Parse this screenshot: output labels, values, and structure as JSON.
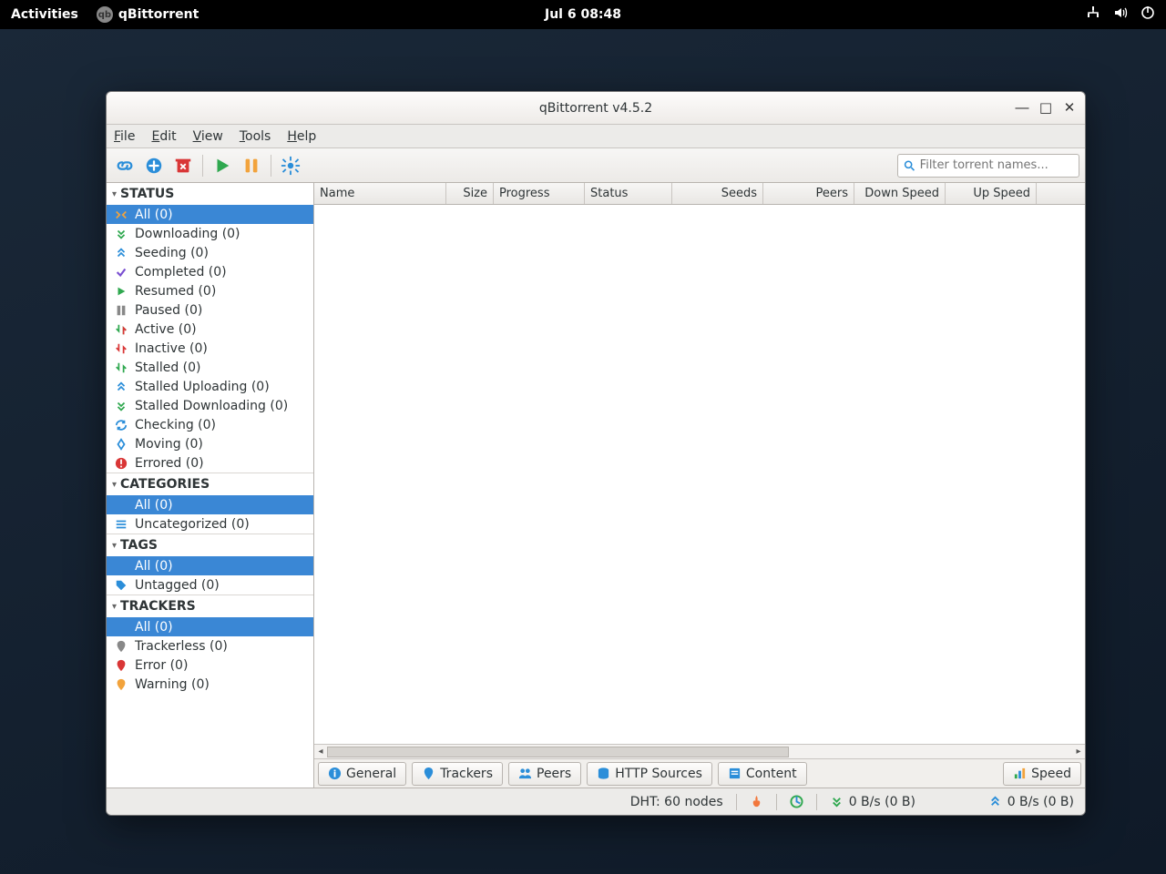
{
  "topbar": {
    "activities": "Activities",
    "app_name": "qBittorrent",
    "datetime": "Jul 6  08:48"
  },
  "window": {
    "title": "qBittorrent v4.5.2"
  },
  "menu": {
    "file": "File",
    "edit": "Edit",
    "view": "View",
    "tools": "Tools",
    "help": "Help"
  },
  "search": {
    "placeholder": "Filter torrent names..."
  },
  "columns": {
    "name": "Name",
    "size": "Size",
    "progress": "Progress",
    "status": "Status",
    "seeds": "Seeds",
    "peers": "Peers",
    "down": "Down Speed",
    "up": "Up Speed"
  },
  "sections": {
    "status": "STATUS",
    "categories": "CATEGORIES",
    "tags": "TAGS",
    "trackers": "TRACKERS"
  },
  "status": {
    "all": "All (0)",
    "downloading": "Downloading (0)",
    "seeding": "Seeding (0)",
    "completed": "Completed (0)",
    "resumed": "Resumed (0)",
    "paused": "Paused (0)",
    "active": "Active (0)",
    "inactive": "Inactive (0)",
    "stalled": "Stalled (0)",
    "stalledup": "Stalled Uploading (0)",
    "stalleddown": "Stalled Downloading (0)",
    "checking": "Checking (0)",
    "moving": "Moving (0)",
    "errored": "Errored (0)"
  },
  "categories": {
    "all": "All (0)",
    "uncat": "Uncategorized (0)"
  },
  "tags": {
    "all": "All (0)",
    "untagged": "Untagged (0)"
  },
  "trackers": {
    "all": "All (0)",
    "trackerless": "Trackerless (0)",
    "error": "Error (0)",
    "warning": "Warning (0)"
  },
  "tabs": {
    "general": "General",
    "trackers": "Trackers",
    "peers": "Peers",
    "http": "HTTP Sources",
    "content": "Content",
    "speed": "Speed"
  },
  "statusbar": {
    "dht": "DHT: 60 nodes",
    "down": "0 B/s (0 B)",
    "up": "0 B/s (0 B)"
  }
}
